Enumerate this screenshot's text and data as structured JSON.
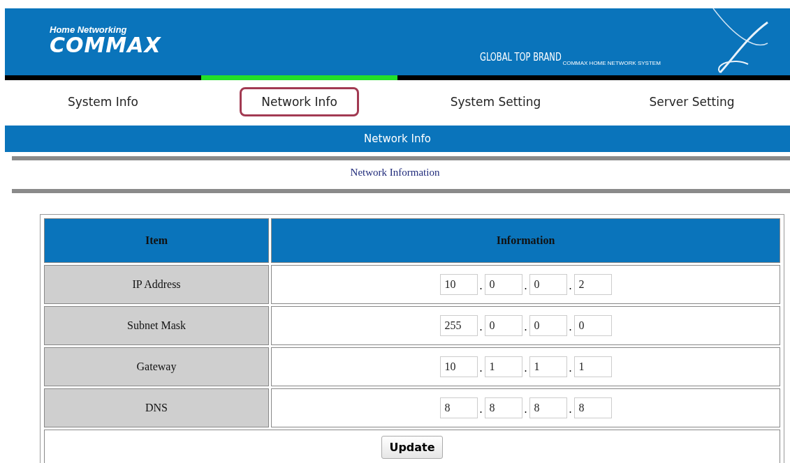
{
  "header": {
    "tagline": "Home Networking",
    "logo": "COMMAX",
    "slogan": "GLOBAL TOP BRAND",
    "slogan_sub": "COMMAX HOME NETWORK SYSTEM"
  },
  "tabs": [
    {
      "label": "System Info",
      "selected": false
    },
    {
      "label": "Network Info",
      "selected": true
    },
    {
      "label": "System Setting",
      "selected": false
    },
    {
      "label": "Server Setting",
      "selected": false
    }
  ],
  "section_bar": "Network Info",
  "section_title": "Network Information",
  "table": {
    "columns": [
      "Item",
      "Information"
    ],
    "octet_separator": ".",
    "rows": [
      {
        "item": "IP Address",
        "octets": [
          "10",
          "0",
          "0",
          "2"
        ]
      },
      {
        "item": "Subnet Mask",
        "octets": [
          "255",
          "0",
          "0",
          "0"
        ]
      },
      {
        "item": "Gateway",
        "octets": [
          "10",
          "1",
          "1",
          "1"
        ]
      },
      {
        "item": "DNS",
        "octets": [
          "8",
          "8",
          "8",
          "8"
        ]
      }
    ],
    "button": "Update"
  }
}
